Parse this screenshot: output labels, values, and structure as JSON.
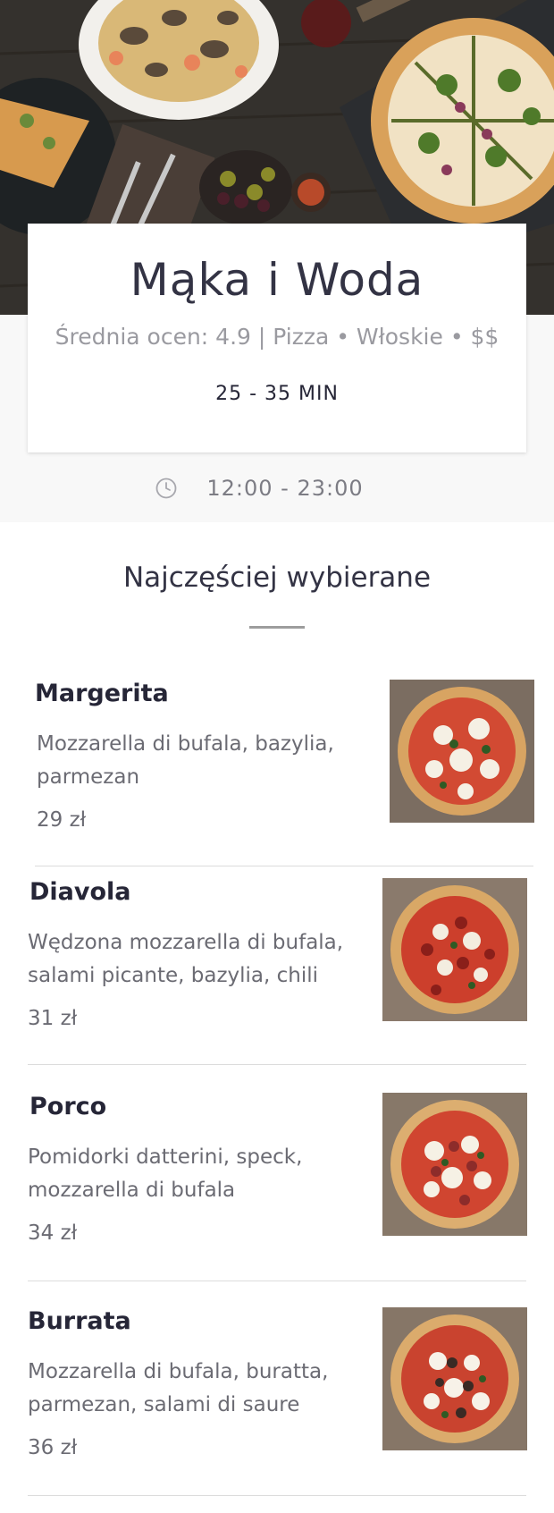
{
  "restaurant": {
    "name": "Mąka i Woda",
    "meta": "Średnia ocen: 4.9 | Pizza • Włoskie • $$",
    "delivery_time": "25 - 35 MIN",
    "hours": "12:00 - 23:00"
  },
  "section": {
    "title": "Najczęściej wybierane"
  },
  "menu": [
    {
      "name": "Margerita",
      "description": "Mozzarella di bufala, bazylia, parmezan",
      "price": "29 zł"
    },
    {
      "name": "Diavola",
      "description": "Wędzona mozzarella di bufala, salami picante, bazylia, chili",
      "price": "31 zł"
    },
    {
      "name": "Porco",
      "description": "Pomidorki datterini, speck, mozzarella di bufala",
      "price": "34 zł"
    },
    {
      "name": "Burrata",
      "description": "Mozzarella di bufala, buratta, parmezan, salami di saure",
      "price": "36 zł"
    }
  ],
  "icons": {
    "hours": "clock-icon"
  },
  "colors": {
    "text_dark": "#262637",
    "text_muted": "#9a9aa0",
    "background_gray": "#f8f8f8"
  }
}
